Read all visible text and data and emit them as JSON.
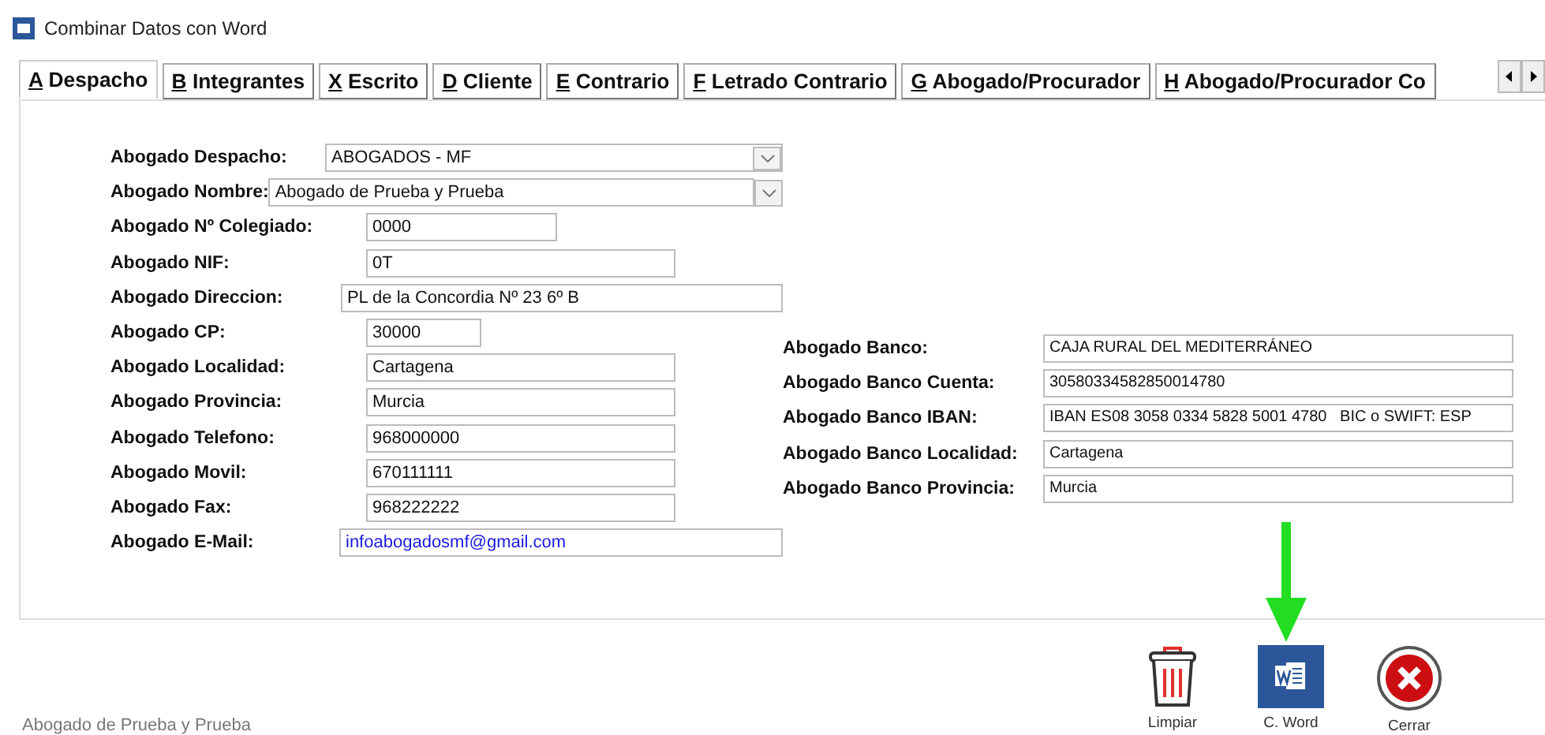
{
  "window": {
    "title": "Combinar Datos con Word"
  },
  "tabs": [
    {
      "label": "A Despacho",
      "selected": true
    },
    {
      "label": "B Integrantes",
      "selected": false
    },
    {
      "label": "X Escrito",
      "selected": false
    },
    {
      "label": "D Cliente",
      "selected": false
    },
    {
      "label": "E Contrario",
      "selected": false
    },
    {
      "label": "F Letrado Contrario",
      "selected": false
    },
    {
      "label": "G Abogado/Procurador",
      "selected": false
    },
    {
      "label": "H Abogado/Procurador Co",
      "selected": false
    }
  ],
  "left_fields": [
    {
      "label": "Abogado Despacho:",
      "value": "ABOGADOS - MF",
      "kind": "select"
    },
    {
      "label": "Abogado Nombre:",
      "value": "Abogado de Prueba y Prueba",
      "kind": "select"
    },
    {
      "label": "Abogado Nº Colegiado:",
      "value": "0000",
      "kind": "text"
    },
    {
      "label": "Abogado NIF:",
      "value": "0T",
      "kind": "text"
    },
    {
      "label": "Abogado Direccion:",
      "value": "PL de la Concordia Nº 23 6º B",
      "kind": "text"
    },
    {
      "label": "Abogado CP:",
      "value": "30000",
      "kind": "text"
    },
    {
      "label": "Abogado Localidad:",
      "value": "Cartagena",
      "kind": "text"
    },
    {
      "label": "Abogado Provincia:",
      "value": "Murcia",
      "kind": "text"
    },
    {
      "label": "Abogado Telefono:",
      "value": "968000000",
      "kind": "text"
    },
    {
      "label": "Abogado Movil:",
      "value": "670111111",
      "kind": "text"
    },
    {
      "label": "Abogado Fax:",
      "value": "968222222",
      "kind": "text"
    },
    {
      "label": "Abogado E-Mail:",
      "value": "infoabogadosmf@gmail.com",
      "kind": "email"
    }
  ],
  "right_fields": [
    {
      "label": "Abogado Banco:",
      "value": "CAJA RURAL DEL MEDITERRÁNEO",
      "kind": "text"
    },
    {
      "label": "Abogado Banco Cuenta:",
      "value": "30580334582850014780",
      "kind": "text"
    },
    {
      "label": "Abogado Banco IBAN:",
      "value": "IBAN ES08 3058 0334 5828 5001 4780   BIC o SWIFT: ESP",
      "kind": "text"
    },
    {
      "label": "Abogado Banco Localidad:",
      "value": "Cartagena",
      "kind": "text"
    },
    {
      "label": "Abogado Banco Provincia:",
      "value": "Murcia",
      "kind": "text"
    }
  ],
  "status_text": "Abogado de Prueba y Prueba",
  "buttons": [
    {
      "label": "Limpiar",
      "kind": "clear"
    },
    {
      "label": "C. Word",
      "kind": "word"
    },
    {
      "label": "Cerrar",
      "kind": "close"
    }
  ]
}
